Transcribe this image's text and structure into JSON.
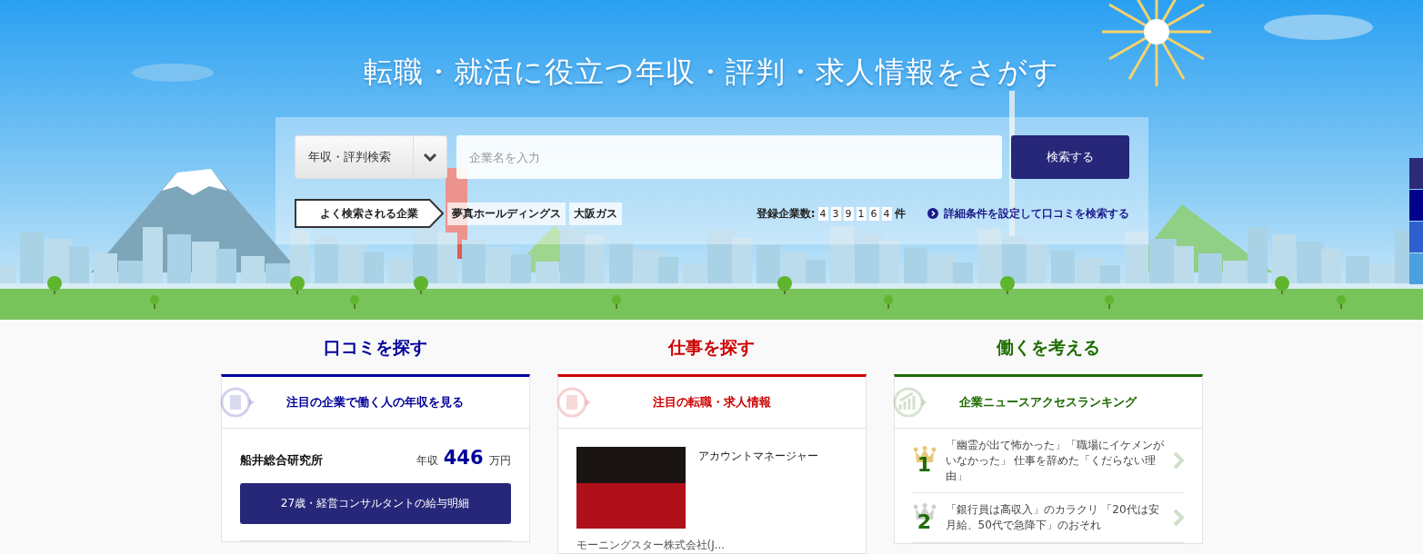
{
  "hero": {
    "title": "転職・就活に役立つ年収・評判・求人情報をさがす",
    "search": {
      "category": "年収・評判検索",
      "placeholder": "企業名を入力",
      "button": "検索する"
    },
    "popular": {
      "label": "よく検索される企業",
      "companies": [
        "夢真ホールディングス",
        "大阪ガス"
      ]
    },
    "count": {
      "label": "登録企業数:",
      "digits": [
        "4",
        "3",
        "9",
        "1",
        "6",
        "4"
      ],
      "unit": "件"
    },
    "advanced_link": "詳細条件を設定して口コミを検索する"
  },
  "columns": [
    {
      "kind": "reviews",
      "title": "口コミを探す",
      "color": "#000099",
      "heading": "注目の企業で働く人の年収を見る",
      "company": "船井総合研究所",
      "salary_label": "年収",
      "salary": "446",
      "salary_unit": "万円",
      "button": "27歳・経営コンサルタントの給与明細"
    },
    {
      "kind": "jobs",
      "title": "仕事を探す",
      "color": "#cc0000",
      "heading": "注目の転職・求人情報",
      "job_title": "アカウントマネージャー",
      "company": "モーニングスター株式会社(J..."
    },
    {
      "kind": "ranking",
      "title": "働くを考える",
      "color": "#1e6b00",
      "heading": "企業ニュースアクセスランキング",
      "items": [
        {
          "rank": "1",
          "text": "「幽霊が出て怖かった」「職場にイケメンがいなかった」 仕事を辞めた「くだらない理由」"
        },
        {
          "rank": "2",
          "text": "「銀行員は高収入」のカラクリ 「20代は安月給、50代で急降下」のおそれ"
        }
      ]
    }
  ]
}
